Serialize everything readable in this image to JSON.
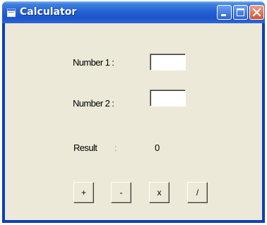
{
  "window": {
    "title": "Calculator"
  },
  "form": {
    "number1_label": "Number 1 :",
    "number1_value": "",
    "number2_label": "Number 2 :",
    "number2_value": "",
    "result_label": "Result",
    "result_separator": ":",
    "result_value": "0"
  },
  "buttons": {
    "add": "+",
    "subtract": "-",
    "multiply": "x",
    "divide": "/"
  },
  "icons": {
    "app": "form-icon",
    "minimize": "minimize-icon",
    "maximize": "maximize-icon",
    "close": "close-icon"
  },
  "colors": {
    "titlebar": "#1c55c8",
    "window_frame": "#0a3fb8",
    "client_background": "#ece9d8",
    "close_button": "#d3502d"
  }
}
